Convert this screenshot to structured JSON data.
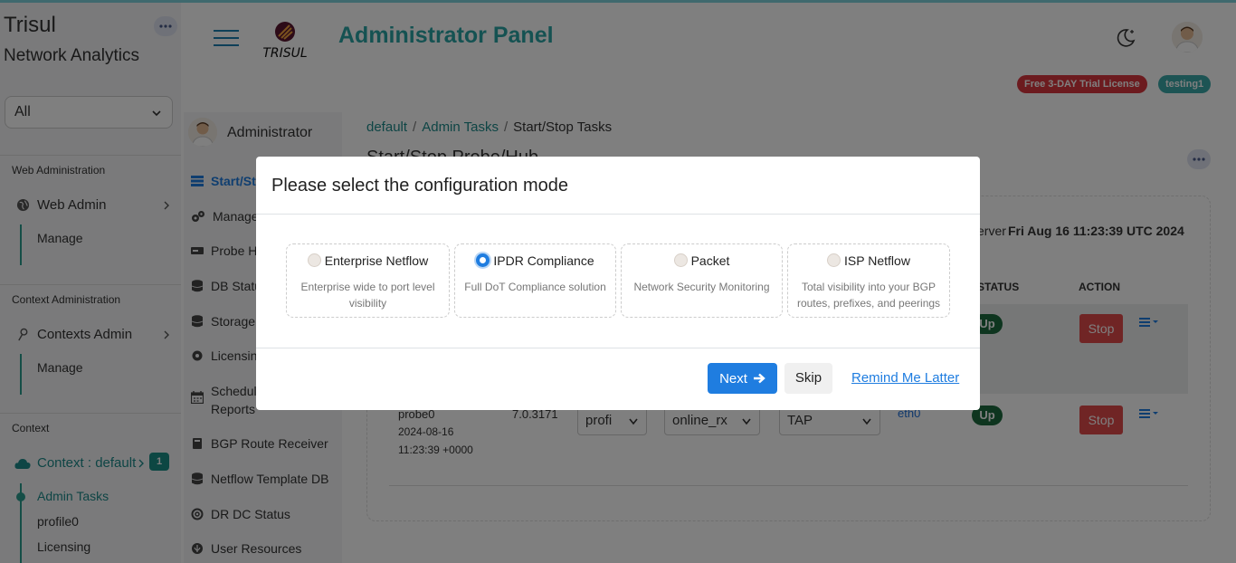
{
  "app": {
    "brand_line1": "Trisul",
    "brand_line2": "Network Analytics",
    "logo_text": "TRISUL",
    "title": "Administrator Panel"
  },
  "context_select": {
    "value": "All"
  },
  "left_sidebar": {
    "web_admin": {
      "heading": "Web Administration",
      "item": "Web Admin",
      "sub": "Manage"
    },
    "ctx_admin": {
      "heading": "Context Administration",
      "item": "Contexts Admin",
      "sub": "Manage"
    },
    "context": {
      "heading": "Context",
      "item": "Context : default",
      "badge": "1",
      "subs": [
        "Admin Tasks",
        "profile0",
        "Licensing"
      ]
    }
  },
  "header": {
    "license_badge": "Free 3-DAY Trial License",
    "user_badge": "testing1"
  },
  "secondary_sidebar": {
    "user": "Administrator",
    "items": [
      "Start/Stop Tasks",
      "Manage Probes",
      "Probe Health",
      "DB Status",
      "Storage",
      "Licensing",
      "Schedule",
      "Reports",
      "BGP Route Receiver",
      "Netflow Template DB",
      "DR DC Status",
      "User Resources"
    ]
  },
  "breadcrumb": {
    "items": [
      "default",
      "Admin Tasks",
      "Start/Stop Tasks"
    ]
  },
  "page": {
    "title": "Start/Stop Probe/Hub",
    "server_time_label": "erver",
    "server_time": "Fri Aug 16 11:23:39 UTC 2024",
    "col_status": "STATUS",
    "col_action": "ACTION"
  },
  "rows": [
    {
      "status": "Up",
      "action": "Stop"
    },
    {
      "name": "probe0",
      "date": "2024-08-16",
      "time": "11:23:39 +0000",
      "version": "7.0.3171",
      "profile": "profi",
      "mode": "online_rx",
      "tap": "TAP",
      "iface": "eth0",
      "status": "Up",
      "action": "Stop"
    }
  ],
  "modal": {
    "title": "Please select the configuration mode",
    "options": [
      {
        "label": "Enterprise Netflow",
        "desc": "Enterprise wide to port level visibility",
        "selected": false
      },
      {
        "label": "IPDR Compliance",
        "desc": "Full DoT Compliance solution",
        "selected": true
      },
      {
        "label": "Packet",
        "desc": "Network Security Monitoring",
        "selected": false
      },
      {
        "label": "ISP Netflow",
        "desc": "Total visibility into your BGP routes, prefixes, and peerings",
        "selected": false
      }
    ],
    "next": "Next",
    "skip": "Skip",
    "remind": "Remind Me Latter"
  },
  "colors": {
    "accent": "#2aa5a5",
    "primary": "#1f7de0",
    "danger": "#e04b4b",
    "success": "#1c6b3e",
    "license_badge": "#d9363e",
    "user_badge": "#3aa8a8"
  }
}
